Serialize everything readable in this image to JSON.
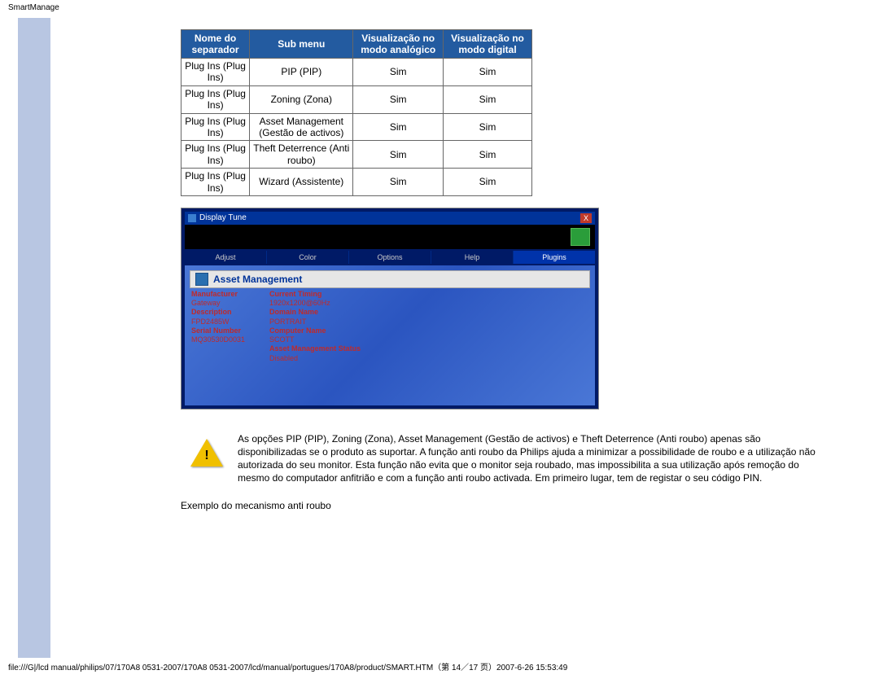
{
  "page": {
    "header_title": "SmartManage",
    "footer_path": "file:///G|/lcd manual/philips/07/170A8 0531-2007/170A8 0531-2007/lcd/manual/portugues/170A8/product/SMART.HTM（第 14／17 页）2007-6-26 15:53:49"
  },
  "table": {
    "headers": [
      "Nome do separador",
      "Sub menu",
      "Visualização no modo analógico",
      "Visualização no modo digital"
    ],
    "rows": [
      [
        "Plug Ins (Plug Ins)",
        "PIP (PIP)",
        "Sim",
        "Sim"
      ],
      [
        "Plug Ins (Plug Ins)",
        "Zoning (Zona)",
        "Sim",
        "Sim"
      ],
      [
        "Plug Ins (Plug Ins)",
        "Asset Management (Gestão de activos)",
        "Sim",
        "Sim"
      ],
      [
        "Plug Ins (Plug Ins)",
        "Theft Deterrence (Anti roubo)",
        "Sim",
        "Sim"
      ],
      [
        "Plug Ins (Plug Ins)",
        "Wizard (Assistente)",
        "Sim",
        "Sim"
      ]
    ]
  },
  "screenshot": {
    "window_title": "Display Tune",
    "close_label": "X",
    "tabs": [
      "Adjust",
      "Color",
      "Options",
      "Help",
      "Plugins"
    ],
    "active_tab_index": 4,
    "panel_title": "Asset Management",
    "left_col": [
      {
        "label": "Manufacturer",
        "value": "Gateway"
      },
      {
        "label": "Description",
        "value": "FPD2485W"
      },
      {
        "label": "Serial Number",
        "value": "MQ30530D0031"
      }
    ],
    "right_col": [
      {
        "label": "Current Timing",
        "value": "1920x1200@60Hz"
      },
      {
        "label": "Domain Name",
        "value": "PORTRAIT"
      },
      {
        "label": "Computer Name",
        "value": "SCOTT"
      },
      {
        "label": "Asset Management Status",
        "value": "Disabled"
      }
    ]
  },
  "warning": {
    "text": "As opções PIP (PIP), Zoning (Zona), Asset Management (Gestão de activos) e Theft Deterrence (Anti roubo) apenas são disponibilizadas se o produto as suportar. A função anti roubo da Philips ajuda a minimizar a possibilidade de roubo e a utilização não autorizada do seu monitor. Esta função não evita que o monitor seja roubado, mas impossibilita a sua utilização após remoção do mesmo do computador anfitrião e com a função anti roubo activada. Em primeiro lugar, tem de registar o seu código PIN."
  },
  "example_line": "Exemplo do mecanismo anti roubo"
}
